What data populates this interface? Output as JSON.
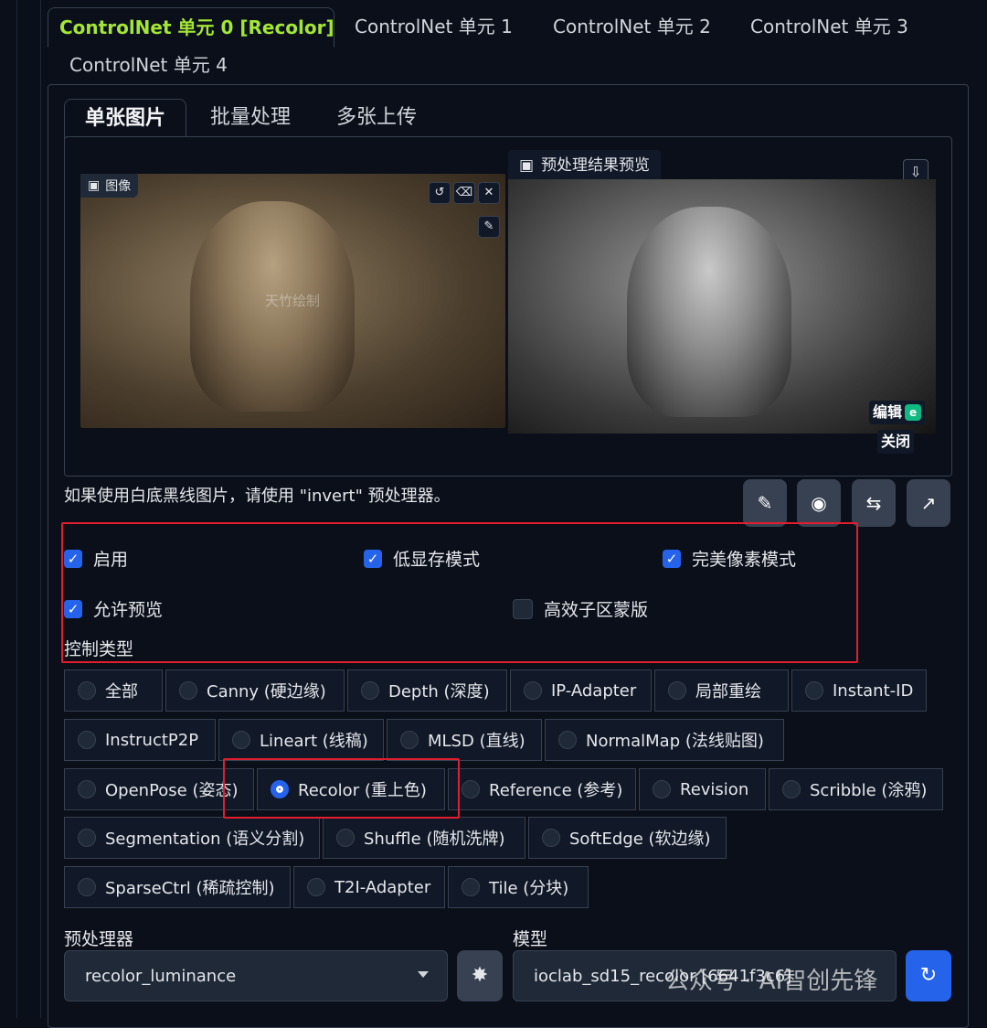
{
  "unit_tabs": [
    {
      "label": "ControlNet 单元 0 [Recolor]",
      "active": true
    },
    {
      "label": "ControlNet 单元 1",
      "active": false
    },
    {
      "label": "ControlNet 单元 2",
      "active": false
    },
    {
      "label": "ControlNet 单元 3",
      "active": false
    },
    {
      "label": "ControlNet 单元 4",
      "active": false
    }
  ],
  "image_tabs": [
    {
      "label": "单张图片",
      "active": true
    },
    {
      "label": "批量处理",
      "active": false
    },
    {
      "label": "多张上传",
      "active": false
    }
  ],
  "image_panel": {
    "input_label": "图像",
    "preview_label": "预处理结果预览",
    "input_watermark": "天竹绘制",
    "edit_badge": "编辑",
    "close_badge": "关闭"
  },
  "hint": "如果使用白底黑线图片，请使用 \"invert\" 预处理器。",
  "checkboxes": [
    {
      "label": "启用",
      "checked": true
    },
    {
      "label": "低显存模式",
      "checked": true
    },
    {
      "label": "完美像素模式",
      "checked": true
    },
    {
      "label": "允许预览",
      "checked": true
    },
    {
      "label": "高效子区蒙版",
      "checked": false
    }
  ],
  "control_type_label": "控制类型",
  "control_types": [
    {
      "label": "全部",
      "selected": false
    },
    {
      "label": "Canny (硬边缘)",
      "selected": false
    },
    {
      "label": "Depth (深度)",
      "selected": false
    },
    {
      "label": "IP-Adapter",
      "selected": false
    },
    {
      "label": "局部重绘",
      "selected": false
    },
    {
      "label": "Instant-ID",
      "selected": false
    },
    {
      "label": "InstructP2P",
      "selected": false
    },
    {
      "label": "Lineart (线稿)",
      "selected": false
    },
    {
      "label": "MLSD (直线)",
      "selected": false
    },
    {
      "label": "NormalMap (法线贴图)",
      "selected": false
    },
    {
      "label": "OpenPose (姿态)",
      "selected": false
    },
    {
      "label": "Recolor (重上色)",
      "selected": true
    },
    {
      "label": "Reference (参考)",
      "selected": false
    },
    {
      "label": "Revision",
      "selected": false
    },
    {
      "label": "Scribble (涂鸦)",
      "selected": false
    },
    {
      "label": "Segmentation (语义分割)",
      "selected": false
    },
    {
      "label": "Shuffle (随机洗牌)",
      "selected": false
    },
    {
      "label": "SoftEdge (软边缘)",
      "selected": false
    },
    {
      "label": "SparseCtrl (稀疏控制)",
      "selected": false
    },
    {
      "label": "T2I-Adapter",
      "selected": false
    },
    {
      "label": "Tile (分块)",
      "selected": false
    }
  ],
  "preprocessor": {
    "label": "预处理器",
    "value": "recolor_luminance"
  },
  "model": {
    "label": "模型",
    "value": "ioclab_sd15_recolor [6641f3c6]"
  },
  "watermark": "公众号 · AI智创先锋",
  "colors": {
    "accent": "#a3e635",
    "primary": "#2563eb",
    "annotation": "#e11d2e",
    "background": "#0b0f19"
  }
}
